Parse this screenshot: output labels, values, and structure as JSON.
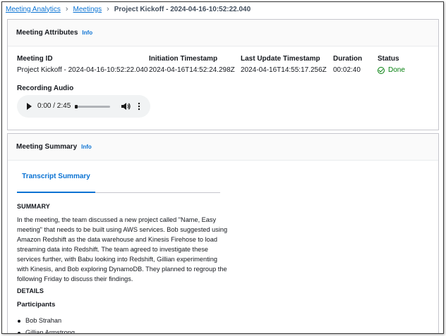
{
  "breadcrumb": {
    "items": [
      "Meeting Analytics",
      "Meetings"
    ],
    "current": "Project Kickoff - 2024-04-16-10:52:22.040"
  },
  "attributes_card": {
    "title": "Meeting Attributes",
    "info_label": "Info",
    "fields": [
      {
        "label": "Meeting ID",
        "value": "Project Kickoff - 2024-04-16-10:52:22.040"
      },
      {
        "label": "Initiation Timestamp",
        "value": "2024-04-16T14:52:24.298Z"
      },
      {
        "label": "Last Update Timestamp",
        "value": "2024-04-16T14:55:17.256Z"
      },
      {
        "label": "Duration",
        "value": "00:02:40"
      },
      {
        "label": "Status",
        "value": "Done"
      }
    ],
    "recording_label": "Recording Audio",
    "audio": {
      "time": "0:00 / 2:45",
      "progress": 0
    }
  },
  "summary_card": {
    "title": "Meeting Summary",
    "info_label": "Info",
    "tabs": [
      "Transcript Summary"
    ],
    "summary_heading": "SUMMARY",
    "summary_text": "In the meeting, the team discussed a new project called \"Name, Easy meeting\" that needs to be built using AWS services. Bob suggested using Amazon Redshift as the data warehouse and Kinesis Firehose to load streaming data into Redshift. The team agreed to investigate these services further, with Babu looking into Redshift, Gillian experimenting with Kinesis, and Bob exploring DynamoDB. They planned to regroup the following Friday to discuss their findings.",
    "details_heading": "DETAILS",
    "participants_heading": "Participants",
    "participants": [
      "Bob Strahan",
      "Gillian Armstrong"
    ]
  },
  "colors": {
    "link": "#0972d3",
    "success": "#037f0c",
    "text": "#16191f"
  }
}
